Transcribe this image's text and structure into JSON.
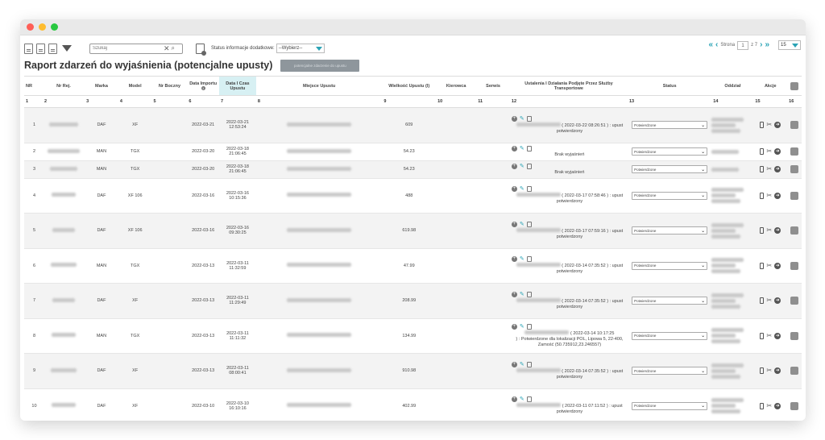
{
  "toolbar": {
    "search_placeholder": "Szukaj",
    "status_label": "Status informacje dodatkowe:",
    "status_value": "--Wybierz--"
  },
  "pager": {
    "page_label": "Strona",
    "page": "1",
    "of_label": "z 7",
    "per_page": "15"
  },
  "report": {
    "title": "Raport zdarzeń do wyjaśnienia (potencjalne upusty)",
    "button_label": "potencjalne zdarzenie do upustu"
  },
  "columns": [
    "NR",
    "Nr Rej.",
    "Marka",
    "Model",
    "Nr Boczny",
    "Data Importu",
    "Data I Czas Upustu",
    "Miejsce Upustu",
    "Wielkość Upustu (l)",
    "Kierowca",
    "Serwis",
    "Ustalenia I Działania Podjęte Przez Służby Transportowe",
    "Status",
    "Oddział",
    "Akcje"
  ],
  "column_numbers": [
    "1",
    "2",
    "3",
    "4",
    "5",
    "6",
    "7",
    "8",
    "9",
    "10",
    "11",
    "12",
    "13",
    "14",
    "15",
    "16"
  ],
  "rows": [
    {
      "nr": "1",
      "marka": "DAF",
      "model": "XF",
      "import": "2022-03-21",
      "date": "2022-03-21",
      "time": "12:53:24",
      "volume": "609",
      "note1": "( 2022-03-22 08:26:51 ) : upust",
      "note2": "potwierdzony",
      "status": "Potwierdzone"
    },
    {
      "nr": "2",
      "marka": "MAN",
      "model": "TGX",
      "import": "2022-03-20",
      "date": "2022-03-18",
      "time": "21:06:45",
      "volume": "54.23",
      "note1": "",
      "note2": "Brak wyjaśnień",
      "status": "Potwierdzone"
    },
    {
      "nr": "3",
      "marka": "MAN",
      "model": "TGX",
      "import": "2022-03-20",
      "date": "2022-03-18",
      "time": "21:06:45",
      "volume": "54.23",
      "note1": "",
      "note2": "Brak wyjaśnień",
      "status": "Potwierdzone"
    },
    {
      "nr": "4",
      "marka": "DAF",
      "model": "XF 106",
      "import": "2022-03-16",
      "date": "2022-03-16",
      "time": "10:15:36",
      "volume": "488",
      "note1": "( 2022-03-17 07:58:46 ) : upust",
      "note2": "potwierdzony",
      "status": "Potwierdzone"
    },
    {
      "nr": "5",
      "marka": "DAF",
      "model": "XF 106",
      "import": "2022-03-16",
      "date": "2022-03-16",
      "time": "09:30:25",
      "volume": "619.98",
      "note1": "( 2022-03-17 07:59:16 ) : upust",
      "note2": "potwierdzony",
      "status": "Potwierdzone"
    },
    {
      "nr": "6",
      "marka": "MAN",
      "model": "TGX",
      "import": "2022-03-13",
      "date": "2022-03-11",
      "time": "11:32:59",
      "volume": "47.99",
      "note1": "( 2022-03-14 07:35:52 ) : upust",
      "note2": "potwierdzony",
      "status": "Potwierdzone"
    },
    {
      "nr": "7",
      "marka": "DAF",
      "model": "XF",
      "import": "2022-03-13",
      "date": "2022-03-11",
      "time": "11:29:49",
      "volume": "208.99",
      "note1": "( 2022-03-14 07:35:52 ) : upust",
      "note2": "potwierdzony",
      "status": "Potwierdzone"
    },
    {
      "nr": "8",
      "marka": "MAN",
      "model": "TGX",
      "import": "2022-03-13",
      "date": "2022-03-11",
      "time": "11:11:32",
      "volume": "134.99",
      "note1": "( 2022-03-14 10:17:25",
      "note2": ") : Potwierdzone dla lokalizacji POL, Lipowa 5, 22-400, Zamość (50.735912,23.246557)",
      "status": "Potwierdzone"
    },
    {
      "nr": "9",
      "marka": "DAF",
      "model": "XF",
      "import": "2022-03-13",
      "date": "2022-03-11",
      "time": "08:00:41",
      "volume": "910.98",
      "note1": "( 2022-03-14 07:35:52 ) : upust",
      "note2": "potwierdzony",
      "status": "Potwierdzone"
    },
    {
      "nr": "10",
      "marka": "DAF",
      "model": "XF",
      "import": "2022-03-10",
      "date": "2022-03-10",
      "time": "16:10:16",
      "volume": "402.99",
      "note1": "( 2022-03-11 07:11:52 ) : upust",
      "note2": "potwierdzony",
      "status": "Potwierdzone"
    }
  ],
  "icons": [
    "pdf-export-icon",
    "csv-export-icon",
    "xls-export-icon",
    "filter-icon",
    "clear-search-icon",
    "search-icon",
    "report-settings-icon",
    "first-page-icon",
    "prev-page-icon",
    "next-page-icon",
    "last-page-icon",
    "add-note-icon",
    "edit-note-icon",
    "history-icon",
    "phone-icon",
    "service-icon",
    "go-icon"
  ],
  "colors": {
    "accent": "#2aa3b5",
    "button_gray": "#8e969c",
    "sorted_column": "#d7f0f3"
  }
}
